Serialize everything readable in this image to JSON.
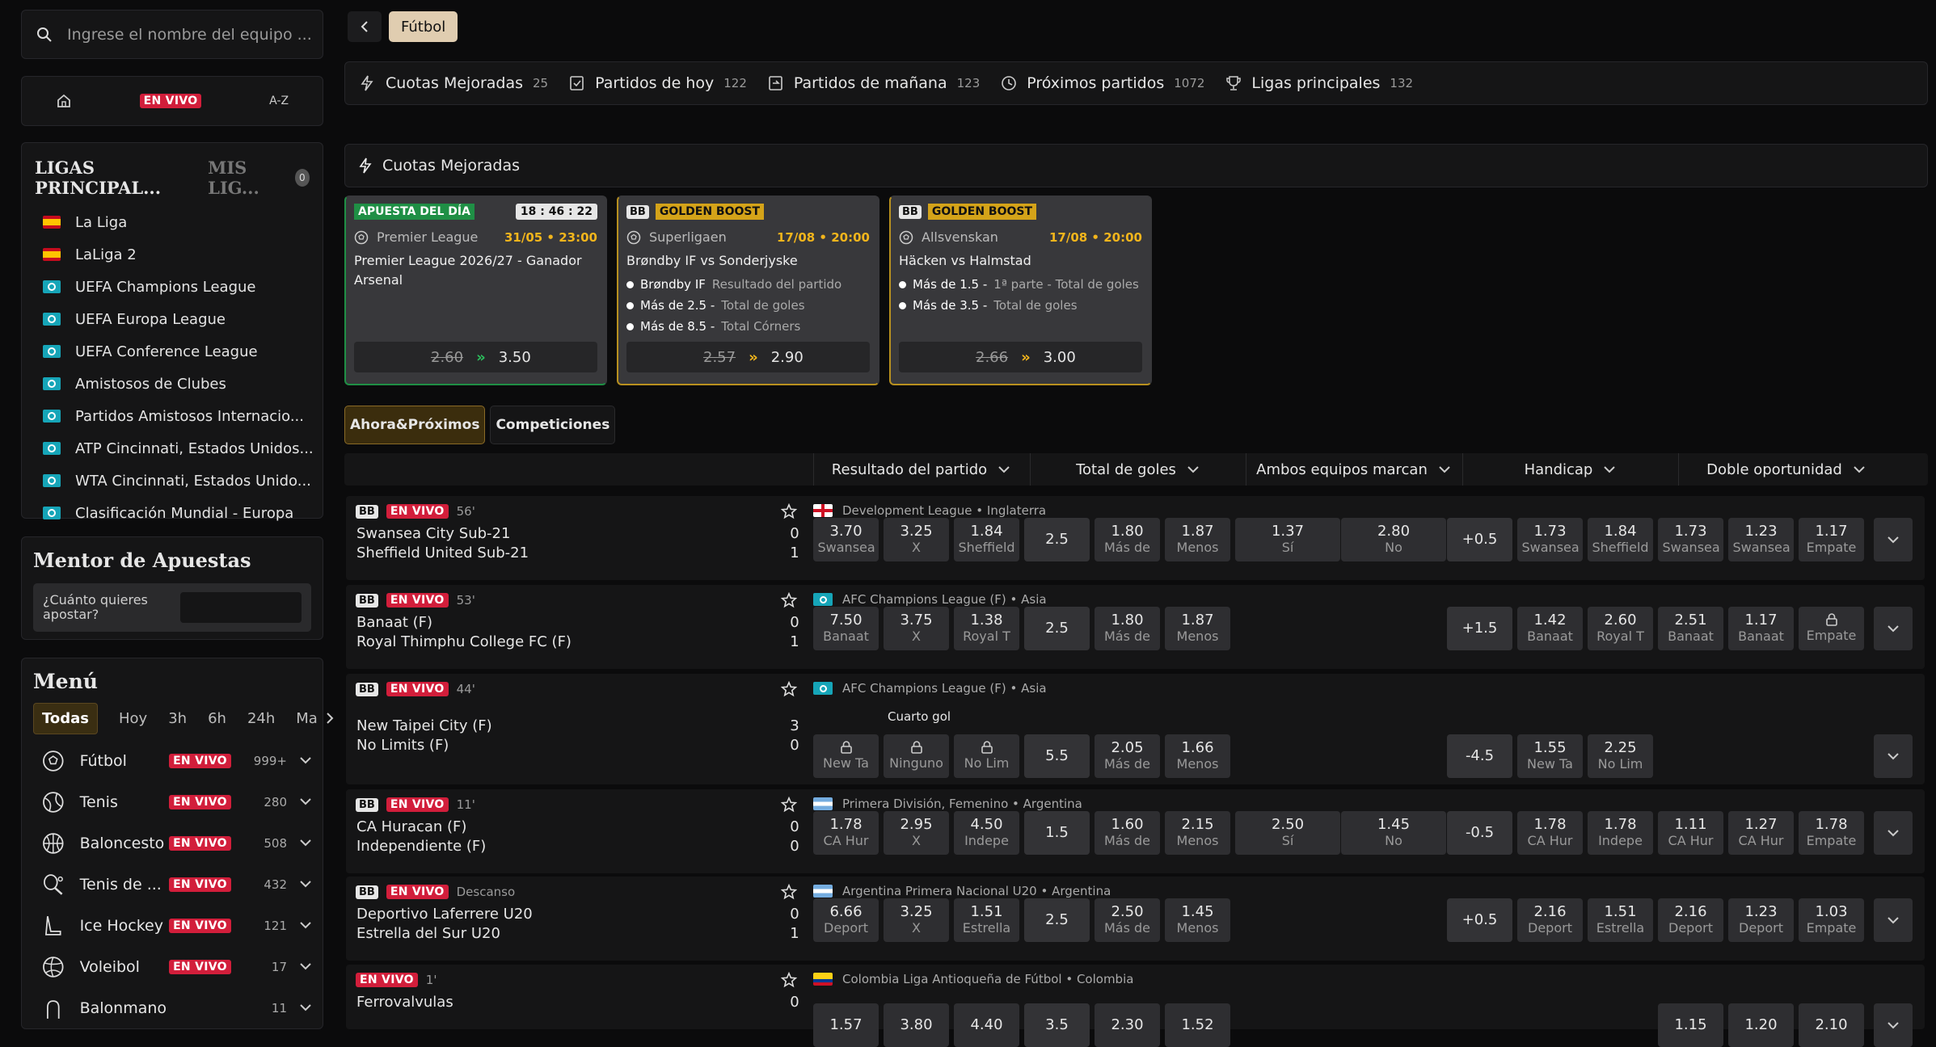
{
  "search": {
    "placeholder": "Ingrese el nombre del equipo ..."
  },
  "modes": {
    "live": "EN VIVO",
    "az": "A-Z"
  },
  "leagues": {
    "tab_main": "LIGAS PRINCIPAL...",
    "tab_mine": "MIS LIG...",
    "mine_count": "0",
    "items": [
      {
        "name": "La Liga",
        "flag": "es"
      },
      {
        "name": "LaLiga 2",
        "flag": "es"
      },
      {
        "name": "UEFA Champions League",
        "flag": "eu"
      },
      {
        "name": "UEFA Europa League",
        "flag": "eu"
      },
      {
        "name": "UEFA Conference League",
        "flag": "eu"
      },
      {
        "name": "Amistosos de Clubes",
        "flag": "eu"
      },
      {
        "name": "Partidos Amistosos Internacio...",
        "flag": "eu"
      },
      {
        "name": "ATP Cincinnati, Estados Unidos...",
        "flag": "eu"
      },
      {
        "name": "WTA Cincinnati, Estados Unido...",
        "flag": "eu"
      },
      {
        "name": "Clasificación Mundial - Europa",
        "flag": "eu"
      }
    ]
  },
  "mentor": {
    "title": "Mentor de Apuestas",
    "question": "¿Cuánto quieres apostar?"
  },
  "menu": {
    "title": "Menú",
    "filters": [
      "Todas",
      "Hoy",
      "3h",
      "6h",
      "24h",
      "Ma"
    ],
    "sports": [
      {
        "name": "Fútbol",
        "live": "EN VIVO",
        "count": "999+"
      },
      {
        "name": "Tenis",
        "live": "EN VIVO",
        "count": "280"
      },
      {
        "name": "Baloncesto",
        "live": "EN VIVO",
        "count": "508"
      },
      {
        "name": "Tenis de ...",
        "live": "EN VIVO",
        "count": "432"
      },
      {
        "name": "Ice Hockey",
        "live": "EN VIVO",
        "count": "121"
      },
      {
        "name": "Voleibol",
        "live": "EN VIVO",
        "count": "17"
      },
      {
        "name": "Balonmano",
        "live": "",
        "count": "11"
      }
    ]
  },
  "breadcrumb": {
    "current": "Fútbol"
  },
  "quick": [
    {
      "label": "Cuotas Mejoradas",
      "count": "25"
    },
    {
      "label": "Partidos de hoy",
      "count": "122"
    },
    {
      "label": "Partidos de mañana",
      "count": "123"
    },
    {
      "label": "Próximos partidos",
      "count": "1072"
    },
    {
      "label": "Ligas principales",
      "count": "132"
    }
  ],
  "boosted": {
    "title": "Cuotas Mejoradas",
    "cards": [
      {
        "bb": "",
        "tag": "APUESTA DEL DÍA",
        "timer": "18 : 46 : 22",
        "league": "Premier League",
        "date": "31/05 • 23:00",
        "title": "Premier League 2026/27 - Ganador",
        "title2": "Arsenal",
        "legs": [],
        "old": "2.60",
        "new": "3.50"
      },
      {
        "bb": "BB",
        "tag": "GOLDEN BOOST",
        "timer": "",
        "league": "Superligaen",
        "date": "17/08 • 20:00",
        "title": "Brøndby IF vs Sonderjyske",
        "title2": "",
        "legs": [
          {
            "a": "Brøndby IF",
            "b": "Resultado del partido"
          },
          {
            "a": "Más de 2.5 -",
            "b": "Total de goles"
          },
          {
            "a": "Más de 8.5 -",
            "b": "Total Córners"
          }
        ],
        "old": "2.57",
        "new": "2.90"
      },
      {
        "bb": "BB",
        "tag": "GOLDEN BOOST",
        "timer": "",
        "league": "Allsvenskan",
        "date": "17/08 • 20:00",
        "title": "Häcken vs Halmstad",
        "title2": "",
        "legs": [
          {
            "a": "Más de 1.5 -",
            "b": "1ª parte - Total de goles"
          },
          {
            "a": "Más de 3.5 -",
            "b": "Total de goles"
          }
        ],
        "old": "2.66",
        "new": "3.00"
      }
    ]
  },
  "tabs": [
    "Ahora&Próximos",
    "Competiciones"
  ],
  "markets": [
    "Resultado del partido",
    "Total de goles",
    "Ambos equipos marcan",
    "Handicap",
    "Doble oportunidad"
  ],
  "events": [
    {
      "bb": "BB",
      "live": "EN VIVO",
      "time": "56'",
      "league": "Development League • Inglaterra",
      "flag": "eng",
      "home": "Swansea City Sub-21",
      "away": "Sheffield United Sub-21",
      "sh": "0",
      "sa": "1",
      "note": "",
      "o": [
        "3.70",
        "Swansea",
        "3.25",
        "X",
        "1.84",
        "Sheffield",
        "2.5",
        "1.80",
        "Más de",
        "1.87",
        "Menos",
        "1.37",
        "Sí",
        "2.80",
        "No",
        "+0.5",
        "1.73",
        "Swansea",
        "1.84",
        "Sheffield",
        "1.73",
        "Swansea",
        "1.23",
        "Swansea",
        "1.17",
        "Empate"
      ]
    },
    {
      "bb": "BB",
      "live": "EN VIVO",
      "time": "53'",
      "league": "AFC Champions League (F) • Asia",
      "flag": "int",
      "home": "Banaat (F)",
      "away": "Royal Thimphu College FC (F)",
      "sh": "0",
      "sa": "1",
      "note": "",
      "o": [
        "7.50",
        "Banaat",
        "3.75",
        "X",
        "1.38",
        "Royal T",
        "2.5",
        "1.80",
        "Más de",
        "1.87",
        "Menos",
        "",
        "",
        "",
        "",
        "+1.5",
        "1.42",
        "Banaat",
        "2.60",
        "Royal T",
        "2.51",
        "Banaat",
        "1.17",
        "Banaat",
        "",
        "Empate"
      ]
    },
    {
      "bb": "BB",
      "live": "EN VIVO",
      "time": "44'",
      "league": "AFC Champions League (F) • Asia",
      "flag": "int",
      "home": "New Taipei City (F)",
      "away": "No Limits (F)",
      "sh": "3",
      "sa": "0",
      "note": "Cuarto gol",
      "o": [
        "",
        "New Ta",
        "",
        "Ninguno",
        "",
        "No Lim",
        "5.5",
        "2.05",
        "Más de",
        "1.66",
        "Menos",
        "",
        "",
        "",
        "",
        "-4.5",
        "1.55",
        "New Ta",
        "2.25",
        "No Lim",
        "",
        "",
        "",
        "",
        "",
        ""
      ]
    },
    {
      "bb": "BB",
      "live": "EN VIVO",
      "time": "11'",
      "league": "Primera División, Femenino • Argentina",
      "flag": "ar",
      "home": "CA Huracan (F)",
      "away": "Independiente (F)",
      "sh": "0",
      "sa": "0",
      "note": "",
      "o": [
        "1.78",
        "CA Hur",
        "2.95",
        "X",
        "4.50",
        "Indepe",
        "1.5",
        "1.60",
        "Más de",
        "2.15",
        "Menos",
        "2.50",
        "Sí",
        "1.45",
        "No",
        "-0.5",
        "1.78",
        "CA Hur",
        "1.78",
        "Indepe",
        "1.11",
        "CA Hur",
        "1.27",
        "CA Hur",
        "1.78",
        "Empate"
      ]
    },
    {
      "bb": "BB",
      "live": "EN VIVO",
      "time": "Descanso",
      "league": "Argentina Primera Nacional U20 • Argentina",
      "flag": "ar",
      "home": "Deportivo Laferrere U20",
      "away": "Estrella del Sur U20",
      "sh": "0",
      "sa": "1",
      "note": "",
      "o": [
        "6.66",
        "Deport",
        "3.25",
        "X",
        "1.51",
        "Estrella",
        "2.5",
        "2.50",
        "Más de",
        "1.45",
        "Menos",
        "",
        "",
        "",
        "",
        "+0.5",
        "2.16",
        "Deport",
        "1.51",
        "Estrella",
        "2.16",
        "Deport",
        "1.23",
        "Deport",
        "1.03",
        "Empate"
      ]
    },
    {
      "bb": "",
      "live": "EN VIVO",
      "time": "1'",
      "league": "Colombia Liga Antioqueña de Fútbol • Colombia",
      "flag": "co",
      "home": "Ferrovalvulas",
      "away": "",
      "sh": "0",
      "sa": "",
      "note": "",
      "o": [
        "1.57",
        "",
        "3.80",
        "",
        "4.40",
        "",
        "3.5",
        "2.30",
        "",
        "1.52",
        "",
        "",
        "",
        "",
        "",
        "",
        "",
        "",
        "",
        "",
        "1.15",
        "",
        "1.20",
        "",
        "2.10",
        ""
      ]
    }
  ],
  "colors": {
    "accent": "#e0cdb0",
    "live": "#d21e3b",
    "boost": "#d4a319",
    "daily": "#1f8f45",
    "odds_up": "#f2b51c"
  }
}
